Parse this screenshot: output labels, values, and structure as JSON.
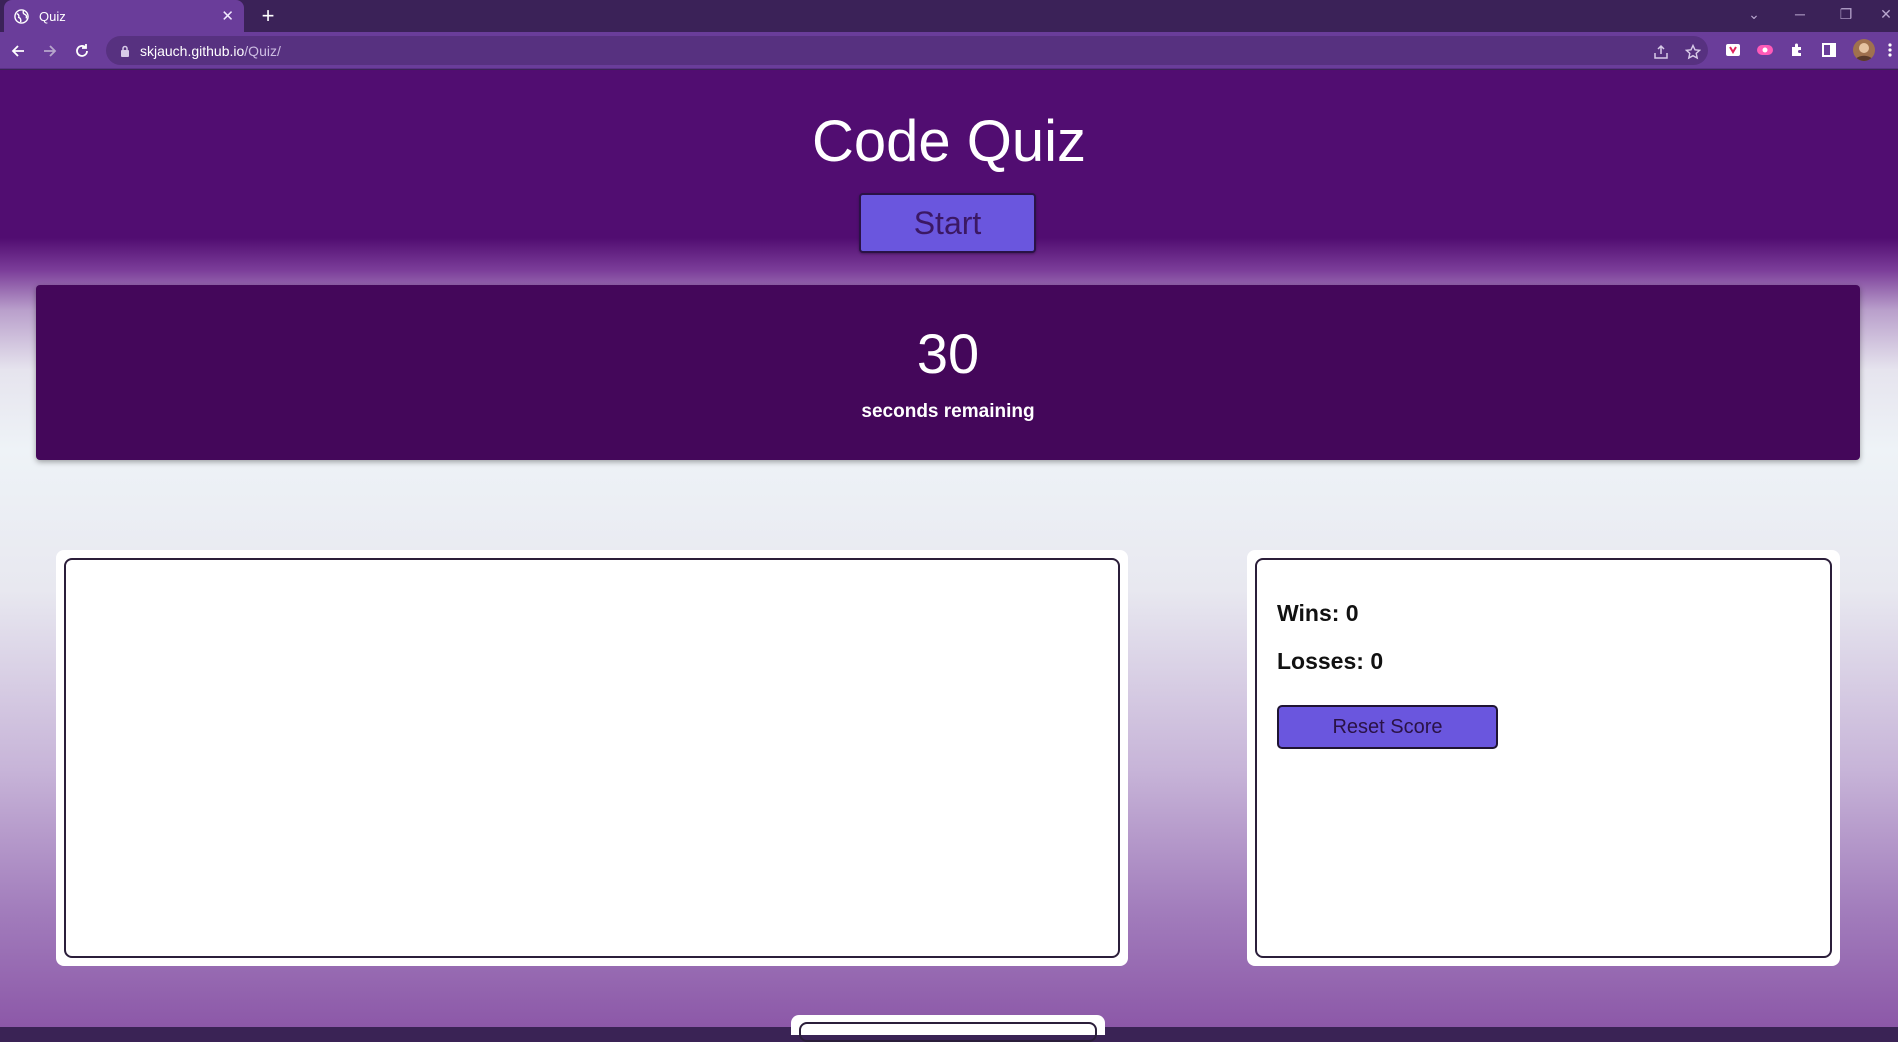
{
  "browser": {
    "tab_title": "Quiz",
    "tab_close": "✕",
    "new_tab": "+",
    "url_host": "skjauch.github.io",
    "url_path": "/Quiz/"
  },
  "page": {
    "title": "Code Quiz",
    "start_label": "Start",
    "timer": {
      "count": "30",
      "label": "seconds remaining"
    },
    "scores": {
      "wins_text": "Wins: 0",
      "losses_text": "Losses: 0",
      "reset_label": "Reset Score"
    }
  },
  "colors": {
    "header_bg": "#510d71",
    "timer_bg": "#44075a",
    "button_bg": "#6a56de",
    "button_text": "#3b1864"
  },
  "icons": [
    "globe-icon",
    "back-icon",
    "forward-icon",
    "reload-icon",
    "lock-icon",
    "share-icon",
    "star-icon",
    "extensions-icon",
    "sidepanel-icon",
    "avatar"
  ]
}
